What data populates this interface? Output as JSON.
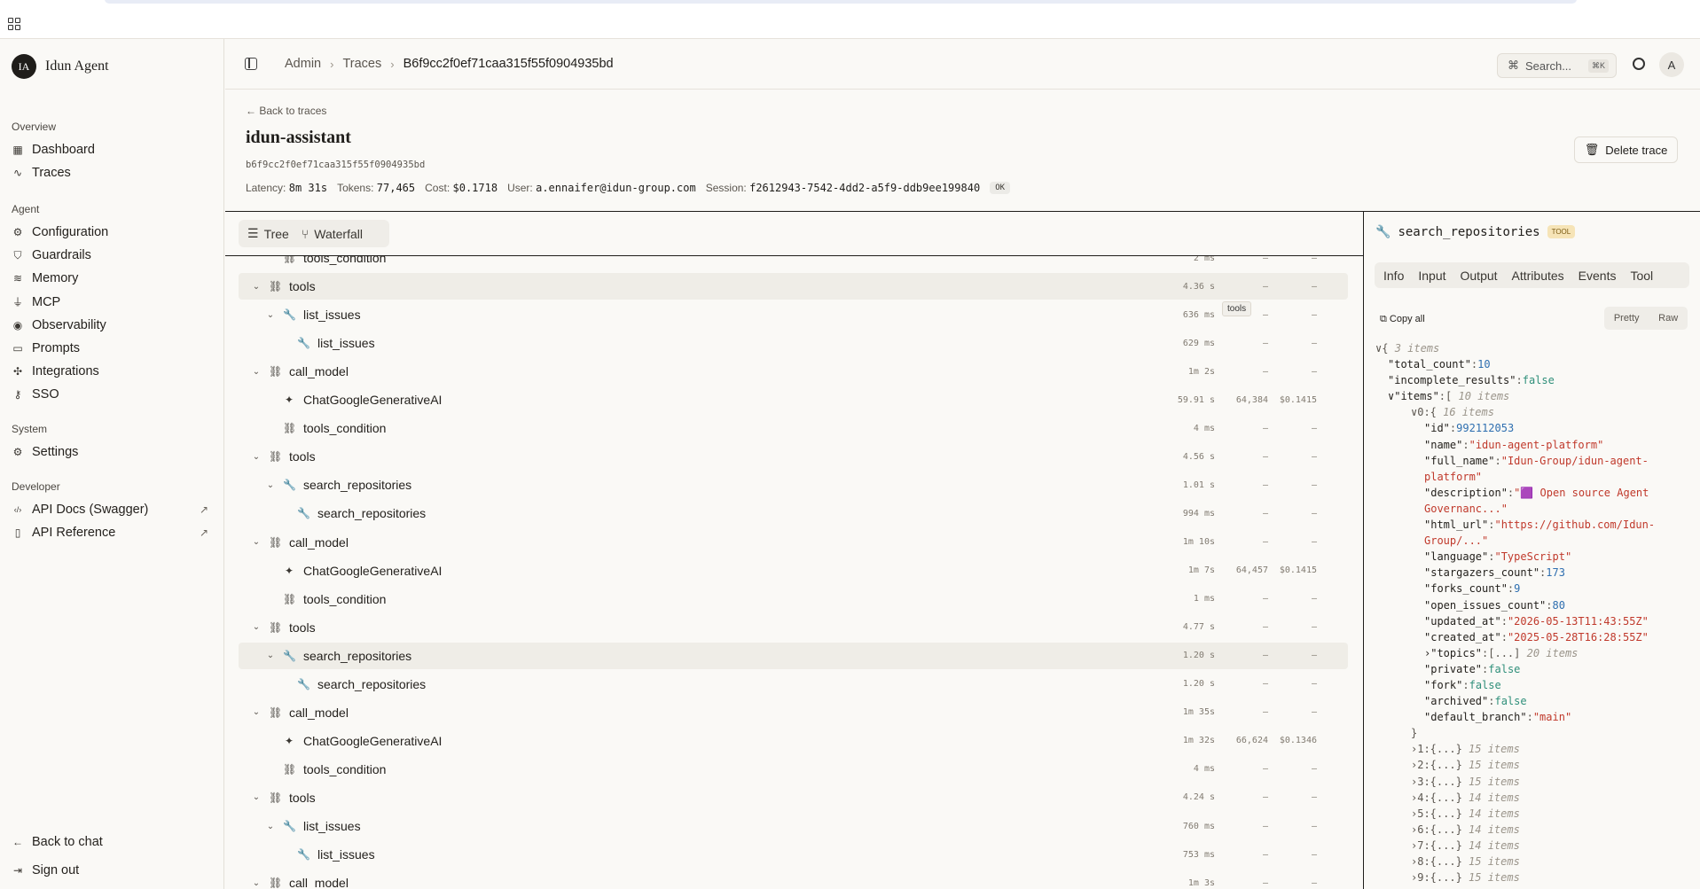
{
  "app": {
    "name": "Idun Agent",
    "logo_initials": "IA"
  },
  "sidebar": {
    "sections": [
      {
        "title": "Overview",
        "items": [
          {
            "label": "Dashboard",
            "icon": "dashboard-icon"
          },
          {
            "label": "Traces",
            "icon": "activity-icon"
          }
        ]
      },
      {
        "title": "Agent",
        "items": [
          {
            "label": "Configuration",
            "icon": "gear-icon"
          },
          {
            "label": "Guardrails",
            "icon": "shield-icon"
          },
          {
            "label": "Memory",
            "icon": "database-icon"
          },
          {
            "label": "MCP",
            "icon": "plug-icon"
          },
          {
            "label": "Observability",
            "icon": "eye-icon"
          },
          {
            "label": "Prompts",
            "icon": "message-icon"
          },
          {
            "label": "Integrations",
            "icon": "puzzle-icon"
          },
          {
            "label": "SSO",
            "icon": "key-icon"
          }
        ]
      },
      {
        "title": "System",
        "items": [
          {
            "label": "Settings",
            "icon": "gear-icon"
          }
        ]
      },
      {
        "title": "Developer",
        "items": [
          {
            "label": "API Docs (Swagger)",
            "icon": "code-icon"
          },
          {
            "label": "API Reference",
            "icon": "book-icon"
          }
        ]
      }
    ],
    "bottom": {
      "back_to_chat": "Back to chat",
      "sign_out": "Sign out"
    }
  },
  "header": {
    "breadcrumb": [
      "Admin",
      "Traces",
      "B6f9cc2f0ef71caa315f55f0904935bd"
    ],
    "search_label": "Search...",
    "search_kbd": "⌘K",
    "avatar": "A"
  },
  "trace": {
    "back_label": "Back to traces",
    "title": "idun-assistant",
    "id": "b6f9cc2f0ef71caa315f55f0904935bd",
    "latency_label": "Latency:",
    "latency": "8m 31s",
    "tokens_label": "Tokens:",
    "tokens": "77,465",
    "cost_label": "Cost:",
    "cost": "$0.1718",
    "user_label": "User:",
    "user": "a.ennaifer@idun-group.com",
    "session_label": "Session:",
    "session": "f2612943-7542-4dd2-a5f9-ddb9ee199840",
    "status": "OK",
    "delete_label": "Delete trace"
  },
  "tree": {
    "views": [
      "Tree",
      "Waterfall"
    ],
    "tooltip": "tools",
    "rows": [
      {
        "depth": 2,
        "kind": "link",
        "name": "tools_condition",
        "chev": "",
        "duration": "2 ms",
        "tokens": "–",
        "cost": "–"
      },
      {
        "depth": 1,
        "kind": "link",
        "name": "tools",
        "chev": "v",
        "duration": "4.36 s",
        "tokens": "–",
        "cost": "–",
        "selected": true
      },
      {
        "depth": 2,
        "kind": "tool",
        "name": "list_issues",
        "chev": "v",
        "duration": "636 ms",
        "tokens": "–",
        "cost": "–"
      },
      {
        "depth": 3,
        "kind": "tool",
        "name": "list_issues",
        "chev": "",
        "duration": "629 ms",
        "tokens": "–",
        "cost": "–"
      },
      {
        "depth": 1,
        "kind": "link",
        "name": "call_model",
        "chev": "v",
        "duration": "1m 2s",
        "tokens": "–",
        "cost": "–"
      },
      {
        "depth": 2,
        "kind": "llm",
        "name": "ChatGoogleGenerativeAI",
        "chev": "",
        "duration": "59.91 s",
        "tokens": "64,384",
        "cost": "$0.1415"
      },
      {
        "depth": 2,
        "kind": "link",
        "name": "tools_condition",
        "chev": "",
        "duration": "4 ms",
        "tokens": "–",
        "cost": "–"
      },
      {
        "depth": 1,
        "kind": "link",
        "name": "tools",
        "chev": "v",
        "duration": "4.56 s",
        "tokens": "–",
        "cost": "–"
      },
      {
        "depth": 2,
        "kind": "tool",
        "name": "search_repositories",
        "chev": "v",
        "duration": "1.01 s",
        "tokens": "–",
        "cost": "–"
      },
      {
        "depth": 3,
        "kind": "tool",
        "name": "search_repositories",
        "chev": "",
        "duration": "994 ms",
        "tokens": "–",
        "cost": "–"
      },
      {
        "depth": 1,
        "kind": "link",
        "name": "call_model",
        "chev": "v",
        "duration": "1m 10s",
        "tokens": "–",
        "cost": "–"
      },
      {
        "depth": 2,
        "kind": "llm",
        "name": "ChatGoogleGenerativeAI",
        "chev": "",
        "duration": "1m 7s",
        "tokens": "64,457",
        "cost": "$0.1415"
      },
      {
        "depth": 2,
        "kind": "link",
        "name": "tools_condition",
        "chev": "",
        "duration": "1 ms",
        "tokens": "–",
        "cost": "–"
      },
      {
        "depth": 1,
        "kind": "link",
        "name": "tools",
        "chev": "v",
        "duration": "4.77 s",
        "tokens": "–",
        "cost": "–"
      },
      {
        "depth": 2,
        "kind": "tool",
        "name": "search_repositories",
        "chev": "v",
        "duration": "1.20 s",
        "tokens": "–",
        "cost": "–",
        "selected": true
      },
      {
        "depth": 3,
        "kind": "tool",
        "name": "search_repositories",
        "chev": "",
        "duration": "1.20 s",
        "tokens": "–",
        "cost": "–"
      },
      {
        "depth": 1,
        "kind": "link",
        "name": "call_model",
        "chev": "v",
        "duration": "1m 35s",
        "tokens": "–",
        "cost": "–"
      },
      {
        "depth": 2,
        "kind": "llm",
        "name": "ChatGoogleGenerativeAI",
        "chev": "",
        "duration": "1m 32s",
        "tokens": "66,624",
        "cost": "$0.1346"
      },
      {
        "depth": 2,
        "kind": "link",
        "name": "tools_condition",
        "chev": "",
        "duration": "4 ms",
        "tokens": "–",
        "cost": "–"
      },
      {
        "depth": 1,
        "kind": "link",
        "name": "tools",
        "chev": "v",
        "duration": "4.24 s",
        "tokens": "–",
        "cost": "–"
      },
      {
        "depth": 2,
        "kind": "tool",
        "name": "list_issues",
        "chev": "v",
        "duration": "760 ms",
        "tokens": "–",
        "cost": "–"
      },
      {
        "depth": 3,
        "kind": "tool",
        "name": "list_issues",
        "chev": "",
        "duration": "753 ms",
        "tokens": "–",
        "cost": "–"
      },
      {
        "depth": 1,
        "kind": "link",
        "name": "call_model",
        "chev": "v",
        "duration": "1m 3s",
        "tokens": "–",
        "cost": "–"
      }
    ]
  },
  "detail": {
    "title": "search_repositories",
    "badge": "TOOL",
    "tabs": [
      "Info",
      "Input",
      "Output",
      "Attributes",
      "Events",
      "Tool"
    ],
    "copy_all": "Copy all",
    "format": [
      "Pretty",
      "Raw"
    ],
    "json_lines": [
      {
        "indent": 0,
        "parts": [
          [
            "pun",
            "∨{ "
          ],
          [
            "cmt",
            "3 items"
          ]
        ]
      },
      {
        "indent": 1,
        "parts": [
          [
            "k",
            "\"total_count\""
          ],
          [
            "pun",
            ":"
          ],
          [
            "num",
            "10"
          ]
        ]
      },
      {
        "indent": 1,
        "parts": [
          [
            "k",
            "\"incomplete_results\""
          ],
          [
            "pun",
            ":"
          ],
          [
            "bool",
            "false"
          ]
        ]
      },
      {
        "indent": 1,
        "parts": [
          [
            "k",
            "∨\"items\""
          ],
          [
            "pun",
            ":[ "
          ],
          [
            "cmt",
            "10 items"
          ]
        ]
      },
      {
        "indent": 2,
        "parts": [
          [
            "pun",
            "∨0:{ "
          ],
          [
            "cmt",
            "16 items"
          ]
        ]
      },
      {
        "indent": 3,
        "parts": [
          [
            "k",
            "\"id\""
          ],
          [
            "pun",
            ":"
          ],
          [
            "num",
            "992112053"
          ]
        ]
      },
      {
        "indent": 3,
        "parts": [
          [
            "k",
            "\"name\""
          ],
          [
            "pun",
            ":"
          ],
          [
            "str",
            "\"idun-agent-platform\""
          ]
        ]
      },
      {
        "indent": 3,
        "parts": [
          [
            "k",
            "\"full_name\""
          ],
          [
            "pun",
            ":"
          ],
          [
            "str",
            "\"Idun-Group/idun-agent-"
          ]
        ]
      },
      {
        "indent": 3,
        "parts": [
          [
            "str",
            "platform\""
          ]
        ]
      },
      {
        "indent": 3,
        "parts": [
          [
            "k",
            "\"description\""
          ],
          [
            "pun",
            ":"
          ],
          [
            "str",
            "\"🟪 Open source Agent"
          ]
        ]
      },
      {
        "indent": 3,
        "parts": [
          [
            "str",
            "Governanc...\""
          ]
        ]
      },
      {
        "indent": 3,
        "parts": [
          [
            "k",
            "\"html_url\""
          ],
          [
            "pun",
            ":"
          ],
          [
            "str",
            "\"https://github.com/Idun-"
          ]
        ]
      },
      {
        "indent": 3,
        "parts": [
          [
            "str",
            "Group/...\""
          ]
        ]
      },
      {
        "indent": 3,
        "parts": [
          [
            "k",
            "\"language\""
          ],
          [
            "pun",
            ":"
          ],
          [
            "str",
            "\"TypeScript\""
          ]
        ]
      },
      {
        "indent": 3,
        "parts": [
          [
            "k",
            "\"stargazers_count\""
          ],
          [
            "pun",
            ":"
          ],
          [
            "num",
            "173"
          ]
        ]
      },
      {
        "indent": 3,
        "parts": [
          [
            "k",
            "\"forks_count\""
          ],
          [
            "pun",
            ":"
          ],
          [
            "num",
            "9"
          ]
        ]
      },
      {
        "indent": 3,
        "parts": [
          [
            "k",
            "\"open_issues_count\""
          ],
          [
            "pun",
            ":"
          ],
          [
            "num",
            "80"
          ]
        ]
      },
      {
        "indent": 3,
        "parts": [
          [
            "k",
            "\"updated_at\""
          ],
          [
            "pun",
            ":"
          ],
          [
            "str",
            "\"2026-05-13T11:43:55Z\""
          ]
        ]
      },
      {
        "indent": 3,
        "parts": [
          [
            "k",
            "\"created_at\""
          ],
          [
            "pun",
            ":"
          ],
          [
            "str",
            "\"2025-05-28T16:28:55Z\""
          ]
        ]
      },
      {
        "indent": 3,
        "parts": [
          [
            "k",
            "›\"topics\""
          ],
          [
            "pun",
            ":[...] "
          ],
          [
            "cmt",
            "20 items"
          ]
        ]
      },
      {
        "indent": 3,
        "parts": [
          [
            "k",
            "\"private\""
          ],
          [
            "pun",
            ":"
          ],
          [
            "bool",
            "false"
          ]
        ]
      },
      {
        "indent": 3,
        "parts": [
          [
            "k",
            "\"fork\""
          ],
          [
            "pun",
            ":"
          ],
          [
            "bool",
            "false"
          ]
        ]
      },
      {
        "indent": 3,
        "parts": [
          [
            "k",
            "\"archived\""
          ],
          [
            "pun",
            ":"
          ],
          [
            "bool",
            "false"
          ]
        ]
      },
      {
        "indent": 3,
        "parts": [
          [
            "k",
            "\"default_branch\""
          ],
          [
            "pun",
            ":"
          ],
          [
            "str",
            "\"main\""
          ]
        ]
      },
      {
        "indent": 2,
        "parts": [
          [
            "pun",
            "}"
          ]
        ]
      },
      {
        "indent": 2,
        "parts": [
          [
            "pun",
            "›1:{...} "
          ],
          [
            "cmt",
            "15 items"
          ]
        ]
      },
      {
        "indent": 2,
        "parts": [
          [
            "pun",
            "›2:{...} "
          ],
          [
            "cmt",
            "15 items"
          ]
        ]
      },
      {
        "indent": 2,
        "parts": [
          [
            "pun",
            "›3:{...} "
          ],
          [
            "cmt",
            "15 items"
          ]
        ]
      },
      {
        "indent": 2,
        "parts": [
          [
            "pun",
            "›4:{...} "
          ],
          [
            "cmt",
            "14 items"
          ]
        ]
      },
      {
        "indent": 2,
        "parts": [
          [
            "pun",
            "›5:{...} "
          ],
          [
            "cmt",
            "14 items"
          ]
        ]
      },
      {
        "indent": 2,
        "parts": [
          [
            "pun",
            "›6:{...} "
          ],
          [
            "cmt",
            "14 items"
          ]
        ]
      },
      {
        "indent": 2,
        "parts": [
          [
            "pun",
            "›7:{...} "
          ],
          [
            "cmt",
            "14 items"
          ]
        ]
      },
      {
        "indent": 2,
        "parts": [
          [
            "pun",
            "›8:{...} "
          ],
          [
            "cmt",
            "15 items"
          ]
        ]
      },
      {
        "indent": 2,
        "parts": [
          [
            "pun",
            "›9:{...} "
          ],
          [
            "cmt",
            "15 items"
          ]
        ]
      }
    ]
  }
}
